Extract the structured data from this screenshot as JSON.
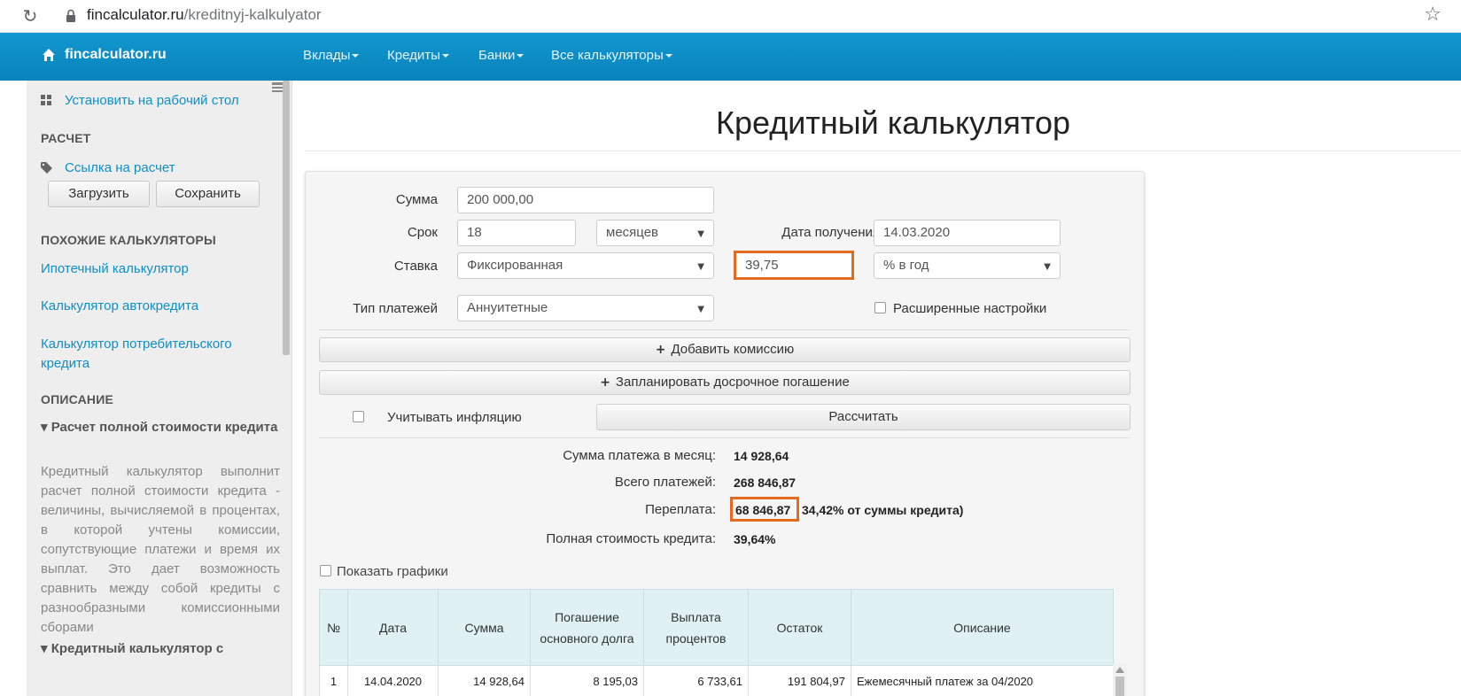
{
  "browser": {
    "url_domain": "fincalculator.ru",
    "url_path": "/kreditnyj-kalkulyator",
    "reload_icon": "reload-icon",
    "star_icon": "star-icon"
  },
  "navbar": {
    "brand": "fincalculator.ru",
    "items": [
      "Вклады",
      "Кредиты",
      "Банки",
      "Все калькуляторы"
    ]
  },
  "sidebar": {
    "install_label": "Установить на рабочий стол",
    "calc_head": "РАСЧЕТ",
    "link_label": "Ссылка на расчет",
    "load_btn": "Загрузить",
    "save_btn": "Сохранить",
    "similar_head": "ПОХОЖИЕ КАЛЬКУЛЯТОРЫ",
    "similar_links": [
      "Ипотечный калькулятор",
      "Калькулятор автокредита",
      "Калькулятор потребительского кредита"
    ],
    "desc_head": "ОПИСАНИЕ",
    "desc_sub1": "▾ Расчет полной стоимости кредита",
    "desc_text": "Кредитный калькулятор выполнит расчет полной стоимости кредита - величины, вычисляемой в процентах, в которой учтены комиссии, сопутствующие платежи и время их выплат. Это дает возможность сравнить между собой кредиты с разнообразными комиссионными сборами",
    "desc_sub2": "▾ Кредитный калькулятор с"
  },
  "main": {
    "title": "Кредитный калькулятор",
    "form": {
      "sum_label": "Сумма",
      "sum_value": "200 000,00",
      "term_label": "Срок",
      "term_value": "18",
      "term_unit": "месяцев",
      "date_label": "Дата получения",
      "date_value": "14.03.2020",
      "rate_label": "Ставка",
      "rate_type": "Фиксированная",
      "rate_value": "39,75",
      "rate_unit": "% в год",
      "pay_type_label": "Тип платежей",
      "pay_type_value": "Аннуитетные",
      "advanced_label": "Расширенные настройки",
      "add_commission": "Добавить комиссию",
      "plan_repayment": "Запланировать досрочное погашение",
      "inflation_label": "Учитывать инфляцию",
      "calculate_btn": "Рассчитать"
    },
    "results": {
      "monthly_label": "Сумма платежа в месяц:",
      "monthly_value": "14 928,64",
      "total_label": "Всего платежей:",
      "total_value": "268 846,87",
      "overpay_label": "Переплата:",
      "overpay_value": "68 846,87",
      "overpay_note": "34,42% от суммы кредита)",
      "full_cost_label": "Полная стоимость кредита:",
      "full_cost_value": "39,64%"
    },
    "show_charts_label": "Показать графики",
    "table": {
      "headers": [
        "№",
        "Дата",
        "Сумма",
        "Погашение основного долга",
        "Выплата процентов",
        "Остаток",
        "Описание"
      ],
      "rows": [
        [
          "1",
          "14.04.2020",
          "14 928,64",
          "8 195,03",
          "6 733,61",
          "191 804,97",
          "Ежемесячный платеж за 04/2020"
        ]
      ]
    }
  }
}
